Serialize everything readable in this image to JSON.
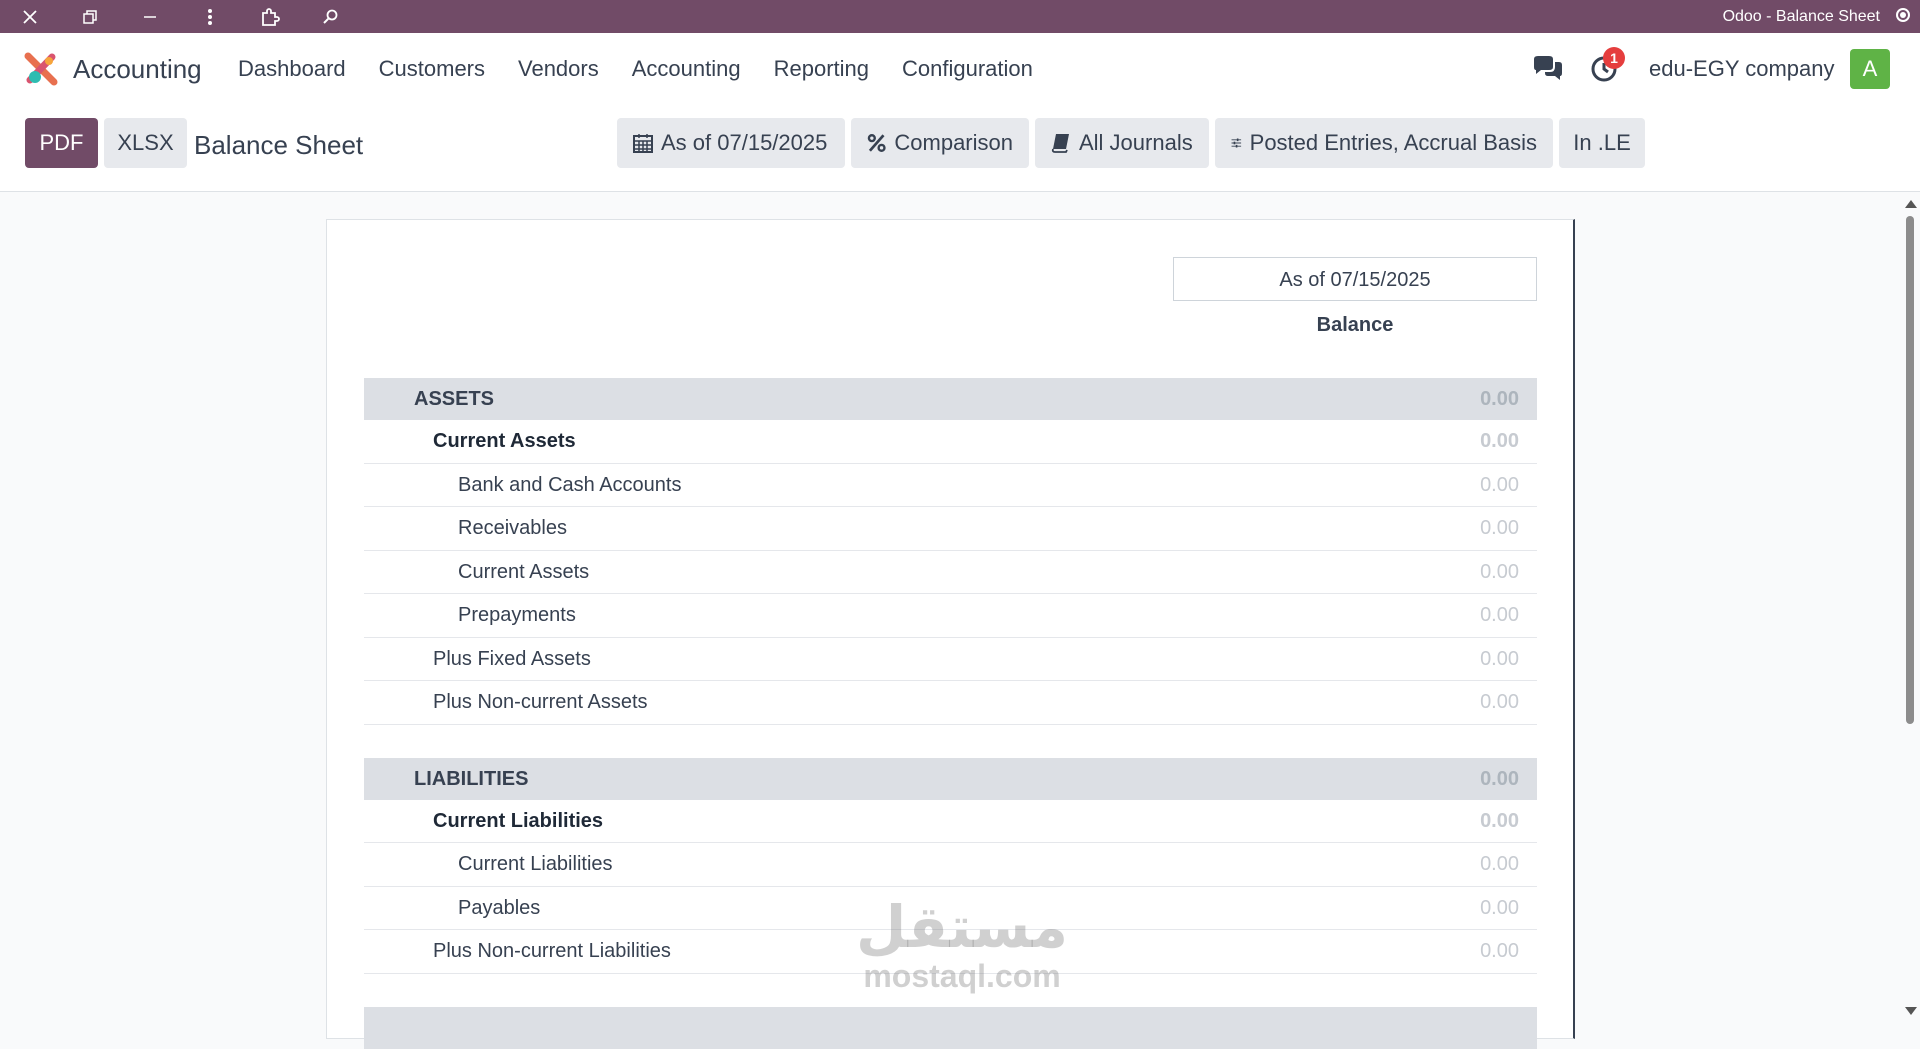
{
  "window": {
    "title": "Odoo - Balance Sheet"
  },
  "navbar": {
    "app_name": "Accounting",
    "menu": [
      "Dashboard",
      "Customers",
      "Vendors",
      "Accounting",
      "Reporting",
      "Configuration"
    ],
    "activity_count": "1",
    "company": "edu-EGY company",
    "avatar_letter": "A",
    "avatar_color": "#5fb346"
  },
  "controls": {
    "pdf_label": "PDF",
    "xlsx_label": "XLSX",
    "page_title": "Balance Sheet",
    "filters": {
      "date": "As of 07/15/2025",
      "comparison": "Comparison",
      "journals": "All Journals",
      "entries": "Posted Entries, Accrual Basis",
      "currency": "In .LE"
    }
  },
  "report": {
    "column_date": "As of 07/15/2025",
    "column_label": "Balance",
    "assets": {
      "label": "ASSETS",
      "value": "0.00",
      "current": {
        "label": "Current Assets",
        "value": "0.00",
        "items": [
          {
            "label": "Bank and Cash Accounts",
            "value": "0.00"
          },
          {
            "label": "Receivables",
            "value": "0.00"
          },
          {
            "label": "Current Assets",
            "value": "0.00"
          },
          {
            "label": "Prepayments",
            "value": "0.00"
          }
        ]
      },
      "fixed": {
        "label": "Plus Fixed Assets",
        "value": "0.00"
      },
      "noncurrent": {
        "label": "Plus Non-current Assets",
        "value": "0.00"
      }
    },
    "liabilities": {
      "label": "LIABILITIES",
      "value": "0.00",
      "current": {
        "label": "Current Liabilities",
        "value": "0.00",
        "items": [
          {
            "label": "Current Liabilities",
            "value": "0.00"
          },
          {
            "label": "Payables",
            "value": "0.00"
          }
        ]
      },
      "noncurrent": {
        "label": "Plus Non-current Liabilities",
        "value": "0.00"
      }
    }
  },
  "watermark": {
    "arabic": "مستقل",
    "latin": "mostaql.com"
  },
  "colors": {
    "brand": "#714b67",
    "section_bg": "#dcdfe4"
  }
}
